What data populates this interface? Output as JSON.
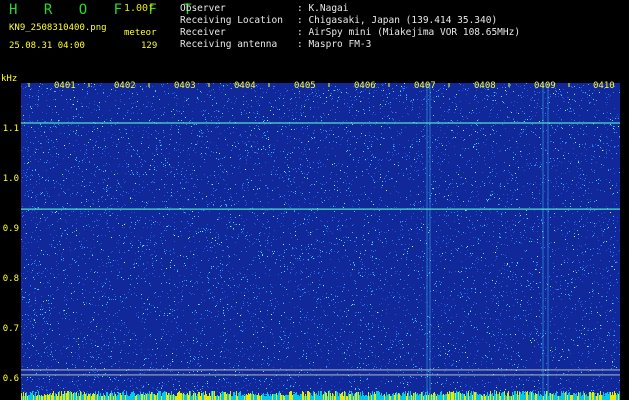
{
  "header": {
    "logo": "H R O F F T",
    "version": "1.00f",
    "filename": "KN9_2508310400.png",
    "mode": "meteor",
    "datetime": "25.08.31 04:00",
    "count": "129"
  },
  "info": [
    {
      "label": "Observer",
      "value": ": K.Nagai"
    },
    {
      "label": "Receiving Location",
      "value": ": Chigasaki, Japan (139.414 35.340)"
    },
    {
      "label": "Receiver",
      "value": ": AirSpy mini (Miakejima VOR 108.65MHz)"
    },
    {
      "label": "Receiving antenna",
      "value": ": Maspro FM-3"
    }
  ],
  "axis": {
    "unit": "kHz",
    "y_ticks": [
      "1.1",
      "1.0",
      "0.9",
      "0.8",
      "0.7",
      "0.6"
    ],
    "x_ticks": [
      "0401",
      "0402",
      "0403",
      "0404",
      "0405",
      "0406",
      "0407",
      "0408",
      "0409",
      "0410"
    ]
  },
  "spectrogram": {
    "freq_range_khz": [
      0.58,
      1.14
    ],
    "carrier_lines_khz": [
      1.108,
      0.937,
      0.618,
      0.608
    ],
    "background_color": "#10289a",
    "speck_colors": [
      "#1e50d8",
      "#2a7cf0",
      "#38b8f0",
      "#55e0e0",
      "#a0f0a0",
      "#e8f060"
    ],
    "bottom_bar_colors": [
      "#00c8e8",
      "#e8e800"
    ]
  }
}
